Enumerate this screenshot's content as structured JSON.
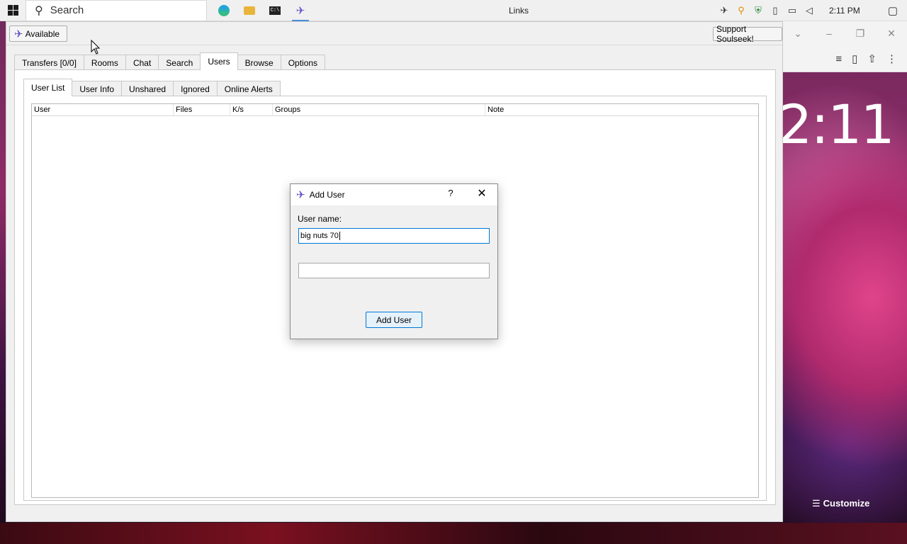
{
  "taskbar": {
    "search_placeholder": "Search",
    "window_title": "Links",
    "time": "2:11 PM",
    "apps": [
      "edge-icon",
      "file-explorer-icon",
      "terminal-icon",
      "soulseek-icon"
    ]
  },
  "background": {
    "lock_clock": "2:11",
    "customize_label": "Customize"
  },
  "app": {
    "status_label": "Available",
    "support_label": "Support Soulseek!",
    "main_tabs": [
      "Transfers [0/0]",
      "Rooms",
      "Chat",
      "Search",
      "Users",
      "Browse",
      "Options"
    ],
    "selected_main_tab": "Users",
    "sub_tabs": [
      "User List",
      "User Info",
      "Unshared",
      "Ignored",
      "Online Alerts"
    ],
    "selected_sub_tab": "User List",
    "columns": [
      "User",
      "Files",
      "K/s",
      "Groups",
      "Note"
    ],
    "rows": []
  },
  "dialog": {
    "title": "Add User",
    "help_label": "?",
    "username_label": "User name:",
    "username_value": "big nuts 70",
    "second_value": "",
    "add_button": "Add User"
  },
  "colors": {
    "accent": "#0078d7",
    "soulseek_bird": "#6a55c8"
  }
}
